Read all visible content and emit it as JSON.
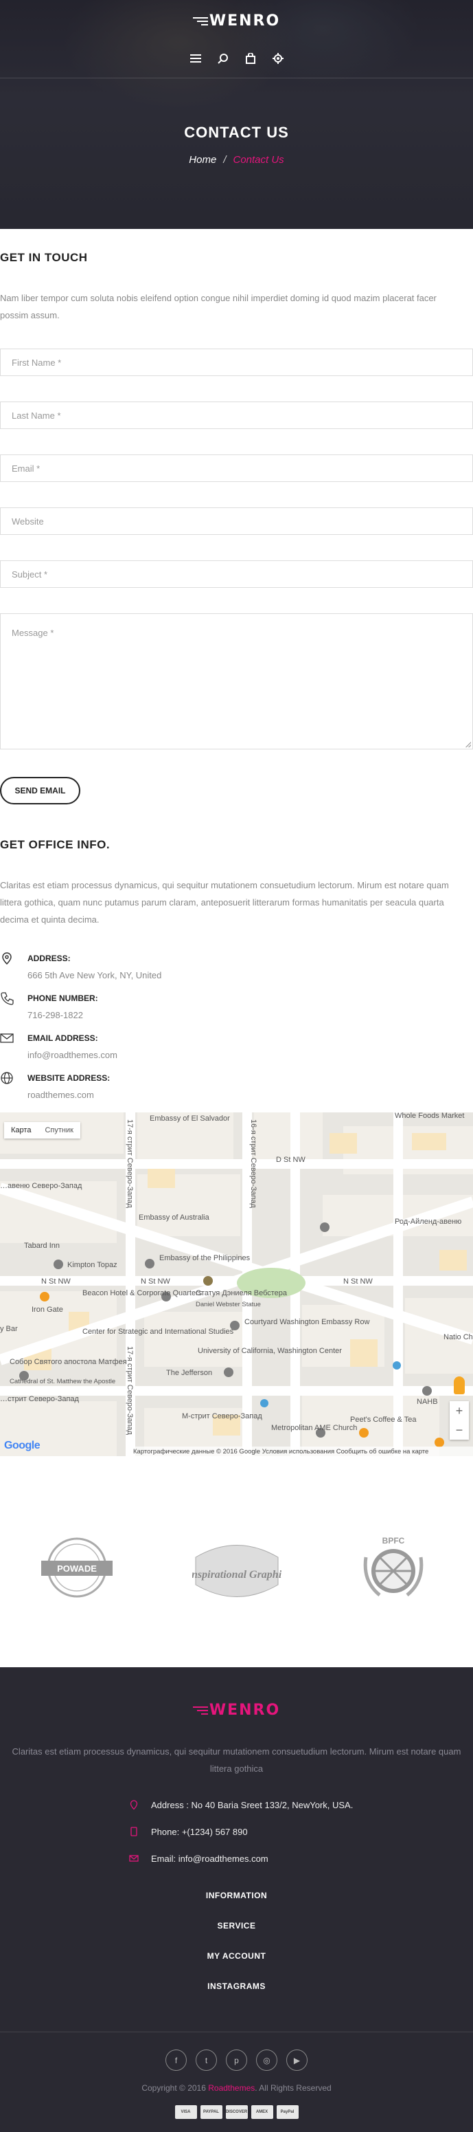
{
  "brand": {
    "logo_text": "WENRO",
    "accent_color": "#e5157c"
  },
  "header": {
    "icons": [
      "menu-icon",
      "search-icon",
      "bag-icon",
      "gear-icon"
    ],
    "title": "CONTACT US",
    "breadcrumb": {
      "home": "Home",
      "separator": "/",
      "current": "Contact Us"
    }
  },
  "get_in_touch": {
    "heading": "GET IN TOUCH",
    "intro": "Nam liber tempor cum soluta nobis eleifend option congue nihil imperdiet doming id quod mazim placerat facer possim assum."
  },
  "form": {
    "first_name": "First Name *",
    "last_name": "Last Name *",
    "email": "Email *",
    "website": "Website",
    "subject": "Subject *",
    "message": "Message *",
    "submit_label": "SEND EMAIL"
  },
  "office": {
    "heading": "GET OFFICE INFO.",
    "intro": "Claritas est etiam processus dynamicus, qui sequitur mutationem consuetudium lectorum. Mirum est notare quam littera gothica, quam nunc putamus parum claram, anteposuerit litterarum formas humanitatis per seacula quarta decima et quinta decima.",
    "items": [
      {
        "icon": "location-pin-icon",
        "label": "ADDRESS:",
        "value": "666 5th Ave New York, NY, United"
      },
      {
        "icon": "phone-icon",
        "label": "PHONE NUMBER:",
        "value": "716-298-1822"
      },
      {
        "icon": "envelope-icon",
        "label": "EMAIL ADDRESS:",
        "value": "info@roadthemes.com"
      },
      {
        "icon": "globe-icon",
        "label": "WEBSITE ADDRESS:",
        "value": "roadthemes.com"
      }
    ]
  },
  "map": {
    "tab_map": "Карта",
    "tab_satellite": "Спутник",
    "zoom_in": "+",
    "zoom_out": "−",
    "google_logo": "Google",
    "attribution": "Картографические данные © 2016 Google     Условия использования     Сообщить об ошибке на карте",
    "labels": {
      "embassy_el_salvador": "Embassy of El Salvador",
      "whole_foods": "Whole Foods Market",
      "st_nw_top": "D St NW",
      "embassy_australia": "Embassy of Australia",
      "rhode_island": "Род-Айленд-авеню",
      "massachusetts": "…авеню Северо-Запад",
      "tabard_inn": "Tabard Inn",
      "kimpton": "Kimpton Topaz",
      "embassy_philippines": "Embassy of the Philippines",
      "n_st_nw_left": "N St NW",
      "n_st_nw_mid": "N St NW",
      "n_st_nw_right": "N St NW",
      "iron_gate": "Iron Gate",
      "beacon_hotel": "Beacon Hotel & Corporate Quarters",
      "webster_statue": "Статуя Дэниеля Вебстера",
      "webster_statue_en": "Daniel Webster Statue",
      "courtyard": "Courtyard Washington Embassy Row",
      "csis": "Center for Strategic and International Studies",
      "univ_california": "University of California, Washington Center",
      "bar": "y Bar",
      "national_christian": "Natio Christian",
      "st_matthew": "Собор Святого апостола Матфея",
      "st_matthew_en": "Cathedral of St. Matthew the Apostle",
      "jefferson": "The Jefferson",
      "nahb": "NAHB",
      "peets": "Peet's Coffee & Tea",
      "metropolitan": "Metropolitan AME Church",
      "m_st_left": "…стрит Северо-Запад",
      "m_st_mid": "М-стрит Северо-Запад",
      "street_16": "16-я стрит Северо-Запад",
      "street_17": "17-я стрит Северо-Запад",
      "street_17b": "17-я стрит Северо-Запад"
    }
  },
  "clients": [
    "POWADE",
    "Inspirational Graphic",
    "BPFC"
  ],
  "footer": {
    "logo_text": "WENRO",
    "about": "Claritas est etiam processus dynamicus, qui sequitur mutationem consuetudium lectorum. Mirum est notare quam littera gothica",
    "address": "Address : No 40 Baria Sreet 133/2, NewYork, USA.",
    "phone": "Phone: +(1234) 567 890",
    "email": "Email: info@roadthemes.com",
    "menu": [
      "INFORMATION",
      "SERVICE",
      "MY ACCOUNT",
      "INSTAGRAMS"
    ],
    "socials": [
      "facebook-icon",
      "twitter-icon",
      "pinterest-icon",
      "dribbble-icon",
      "youtube-icon"
    ],
    "copyright_prefix": "Copyright © 2016",
    "copyright_brand": "Roadthemes",
    "copyright_suffix": ". All Rights Reserved",
    "payments": [
      "VISA",
      "PAYPAL",
      "DISCOVER",
      "AMEX",
      "PayPal"
    ]
  }
}
